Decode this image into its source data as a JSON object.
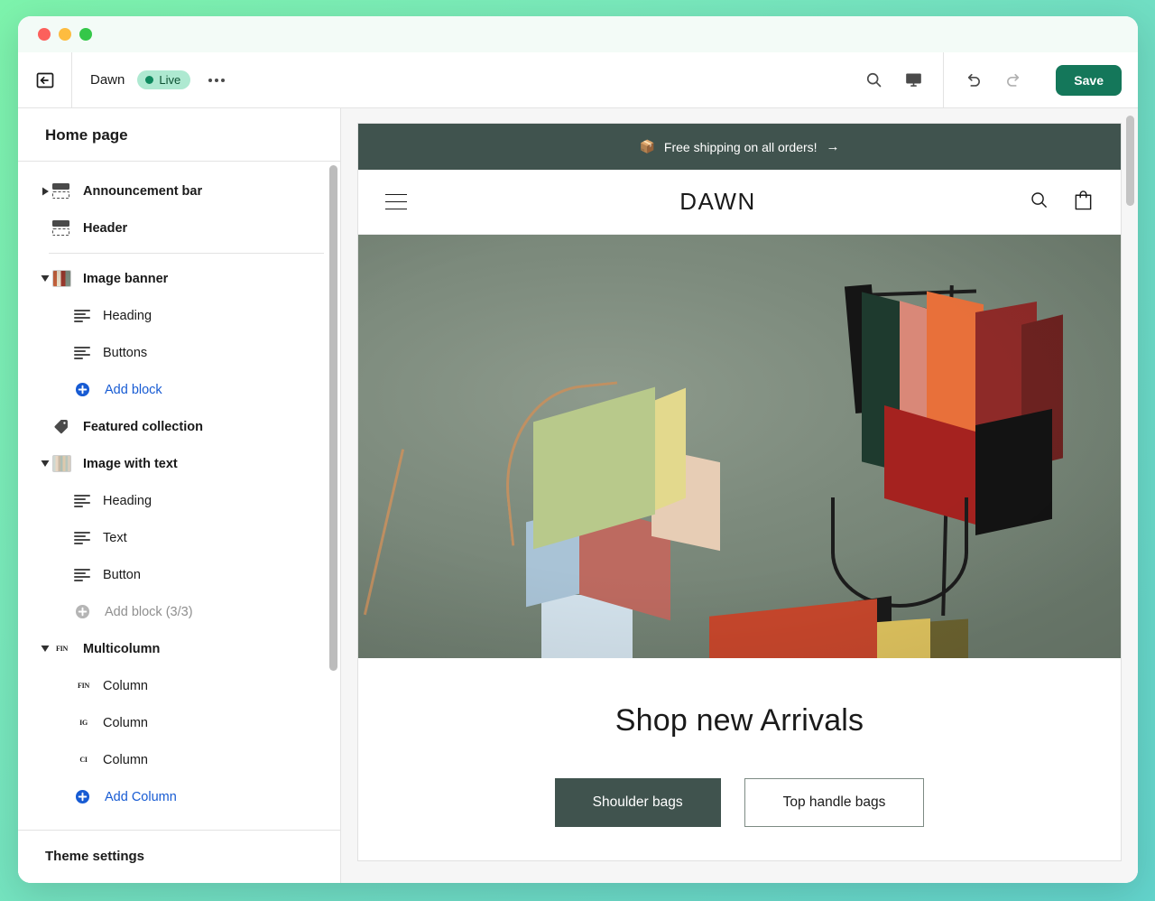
{
  "window": {
    "traffic_lights": [
      "close",
      "minimize",
      "maximize"
    ]
  },
  "toolbar": {
    "back_icon": "arrow-left-box-icon",
    "theme_name": "Dawn",
    "status_badge": "Live",
    "more_menu": "•••",
    "search_icon": "search-icon",
    "device_icon": "desktop-icon",
    "undo_icon": "undo-icon",
    "redo_icon": "redo-icon",
    "save_label": "Save",
    "save_color": "#14775a",
    "badge_bg": "#aee9d1",
    "badge_fg": "#0c5132"
  },
  "sidebar": {
    "title": "Home page",
    "footer_label": "Theme settings",
    "items": [
      {
        "label": "Announcement bar",
        "type": "section",
        "icon": "banner-icon",
        "caret": "collapsed",
        "indent": 0
      },
      {
        "label": "Header",
        "type": "section",
        "icon": "banner-icon",
        "caret": "none",
        "indent": 0
      },
      {
        "label": "Image banner",
        "type": "section",
        "icon": "image-thumb-icon",
        "caret": "expanded",
        "indent": 0
      },
      {
        "label": "Heading",
        "type": "block",
        "icon": "text-lines-icon",
        "caret": "none",
        "indent": 1
      },
      {
        "label": "Buttons",
        "type": "block",
        "icon": "text-lines-icon",
        "caret": "none",
        "indent": 1
      },
      {
        "label": "Add block",
        "type": "add",
        "icon": "plus-circle-icon",
        "caret": "none",
        "indent": 1,
        "disabled": false
      },
      {
        "label": "Featured collection",
        "type": "section",
        "icon": "tag-icon",
        "caret": "none",
        "indent": 0
      },
      {
        "label": "Image with text",
        "type": "section",
        "icon": "image-thumb-icon",
        "caret": "expanded",
        "indent": 0
      },
      {
        "label": "Heading",
        "type": "block",
        "icon": "text-lines-icon",
        "caret": "none",
        "indent": 1
      },
      {
        "label": "Text",
        "type": "block",
        "icon": "text-lines-icon",
        "caret": "none",
        "indent": 1
      },
      {
        "label": "Button",
        "type": "block",
        "icon": "text-lines-icon",
        "caret": "none",
        "indent": 1
      },
      {
        "label": "Add block (3/3)",
        "type": "add",
        "icon": "plus-circle-icon",
        "caret": "none",
        "indent": 1,
        "disabled": true
      },
      {
        "label": "Multicolumn",
        "type": "section",
        "icon": "column-thumb-icon",
        "caret": "expanded",
        "indent": 0
      },
      {
        "label": "Column",
        "type": "block",
        "icon": "column-thumb-icon",
        "caret": "none",
        "indent": 1,
        "thumb_text": "FIN"
      },
      {
        "label": "Column",
        "type": "block",
        "icon": "column-thumb-icon",
        "caret": "none",
        "indent": 1,
        "thumb_text": "IG"
      },
      {
        "label": "Column",
        "type": "block",
        "icon": "column-thumb-icon",
        "caret": "none",
        "indent": 1,
        "thumb_text": "CI"
      },
      {
        "label": "Add Column",
        "type": "add",
        "icon": "plus-circle-icon",
        "caret": "none",
        "indent": 1,
        "disabled": false
      }
    ]
  },
  "preview": {
    "announcement": {
      "emoji": "📦",
      "text": "Free shipping on all orders!",
      "arrow": "→",
      "bg": "#40534e"
    },
    "store_header": {
      "menu_icon": "hamburger-icon",
      "logo": "DAWN",
      "search_icon": "search-icon",
      "cart_icon": "shopping-bag-icon"
    },
    "hero": {
      "image_alt": "Colorful geometric leather handbags on sage green background",
      "background_color": "#7d8b7d",
      "title": "Shop new Arrivals",
      "primary_button": "Shoulder bags",
      "secondary_button": "Top handle bags",
      "primary_color": "#40534e"
    }
  }
}
